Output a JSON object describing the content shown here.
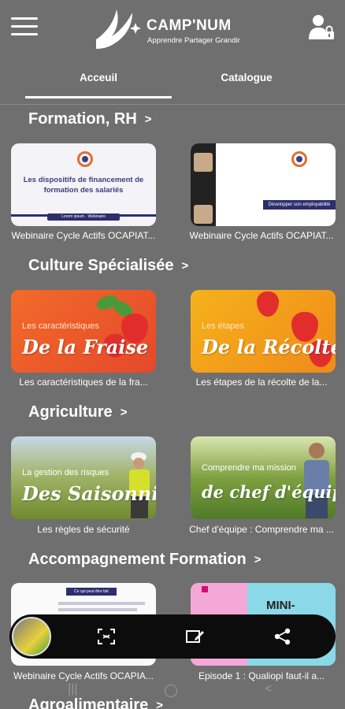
{
  "app": {
    "title": "CAMP'NUM",
    "tagline": "Apprendre Partager Grandir"
  },
  "tabs": [
    {
      "label": "Acceuil",
      "active": true
    },
    {
      "label": "Catalogue",
      "active": false
    }
  ],
  "sections": [
    {
      "title": "Formation, RH",
      "chevron": ">",
      "cards": [
        {
          "caption": "Webinaire Cycle Actifs OCAPIAT...",
          "thumb_text": "Les dispositifs de financement de formation des salariés",
          "thumb_footer": "Lorem ipsum · Webinaire"
        },
        {
          "caption": "Webinaire Cycle Actifs OCAPIAT...",
          "thumb_text": "Développer son employabilité"
        }
      ]
    },
    {
      "title": "Culture Spécialisée",
      "chevron": ">",
      "cards": [
        {
          "caption": "Les caractéristiques de la fra...",
          "thumb_small": "Les caractéristiques",
          "thumb_big": "De la Fraise"
        },
        {
          "caption": "Les étapes de la récolte de la...",
          "thumb_small": "Les étapes",
          "thumb_big": "De la Récolte"
        }
      ]
    },
    {
      "title": "Agriculture",
      "chevron": ">",
      "cards": [
        {
          "caption": "Les règles de sécurité",
          "thumb_small": "La gestion des risques",
          "thumb_big": "Des Saisonniers"
        },
        {
          "caption": "Chef d'équipe : Comprendre ma ...",
          "thumb_small": "Comprendre ma mission",
          "thumb_big": "de chef d'équipe"
        }
      ]
    },
    {
      "title": "Accompagnement Formation",
      "chevron": ">",
      "cards": [
        {
          "caption": "Webinaire Cycle Actifs  OCAPIA...",
          "thumb_text": "Ce qui peut être fait"
        },
        {
          "caption": "Episode 1 : Qualiopi faut-il a...",
          "thumb_text": "MINI-"
        }
      ]
    },
    {
      "title": "Agroalimentaire",
      "chevron": ">"
    }
  ],
  "bottom_toolbar": {
    "icons": [
      "scan-icon",
      "edit-screenshot-icon",
      "share-icon"
    ]
  },
  "system_nav": {
    "icons": [
      "recent-apps-icon",
      "home-icon",
      "back-icon"
    ],
    "recent": "|||",
    "home": "◯",
    "back": "<"
  },
  "colors": {
    "background": "#6f6f6f",
    "text": "#ffffff",
    "toolbar": "#0c0c0c"
  }
}
